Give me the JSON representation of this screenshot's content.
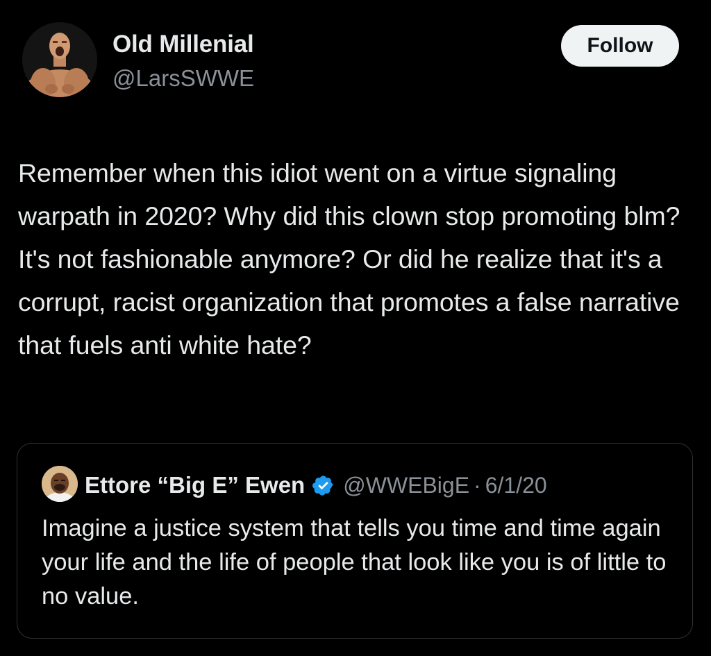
{
  "tweet": {
    "display_name": "Old Millenial",
    "handle": "@LarsSWWE",
    "follow_label": "Follow",
    "text": "Remember when this idiot went on a virtue signaling warpath in 2020? Why did this clown stop promoting blm? It's not fashionable anymore? Or did he realize that it's a corrupt, racist organization that promotes a false narrative that fuels anti white hate?"
  },
  "quote": {
    "display_name": "Ettore “Big E” Ewen",
    "verified": true,
    "verified_icon": "verified-badge-icon",
    "handle": "@WWEBigE",
    "separator": "·",
    "date": "6/1/20",
    "text": "Imagine a justice system that tells you time and time again your life and the life of people that look like you is of little to no value."
  },
  "colors": {
    "background": "#000000",
    "primary_text": "#e7e9ea",
    "secondary_text": "#8b9198",
    "follow_bg": "#eff3f4",
    "border": "#2f3336",
    "verified": "#1d9bf0"
  }
}
